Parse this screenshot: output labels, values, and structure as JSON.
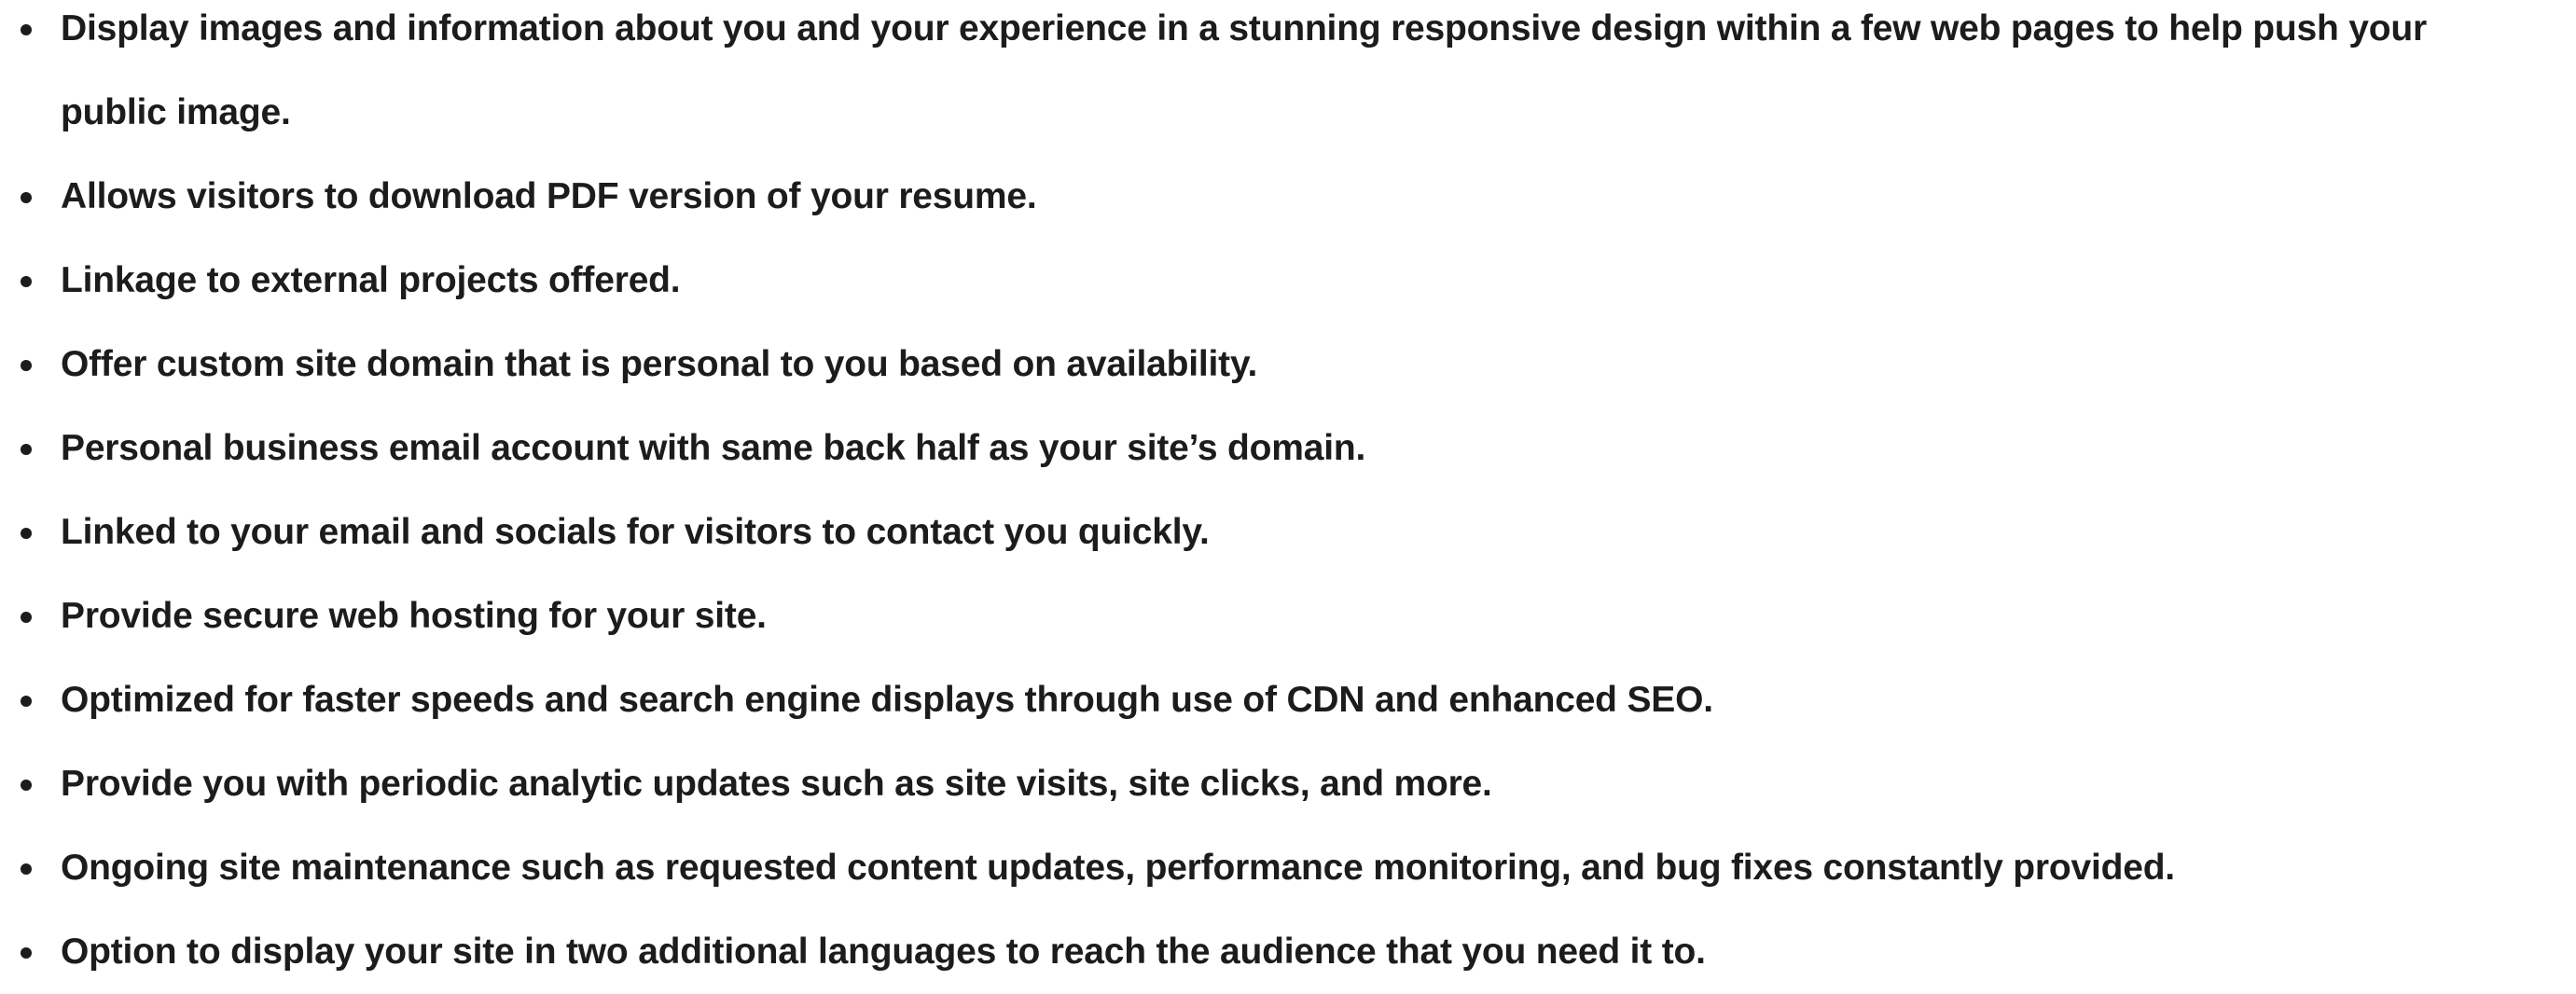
{
  "features": {
    "items": [
      "Display images and information about you and your experience in a stunning responsive design within a few web pages to help push your public image.",
      "Allows visitors to download PDF version of your resume.",
      "Linkage to external projects offered.",
      "Offer custom site domain that is personal to you based on availability.",
      "Personal business email account with same back half as your site’s domain.",
      "Linked to your email and socials for visitors to contact you quickly.",
      "Provide secure web hosting for your site.",
      "Optimized for faster speeds and search engine displays through use of CDN and enhanced SEO.",
      "Provide you with periodic analytic updates such as site visits, site clicks, and more.",
      "Ongoing site maintenance such as requested content updates, performance monitoring, and bug fixes constantly provided.",
      "Option to display your site in two additional languages to reach the audience that you need it to."
    ]
  }
}
